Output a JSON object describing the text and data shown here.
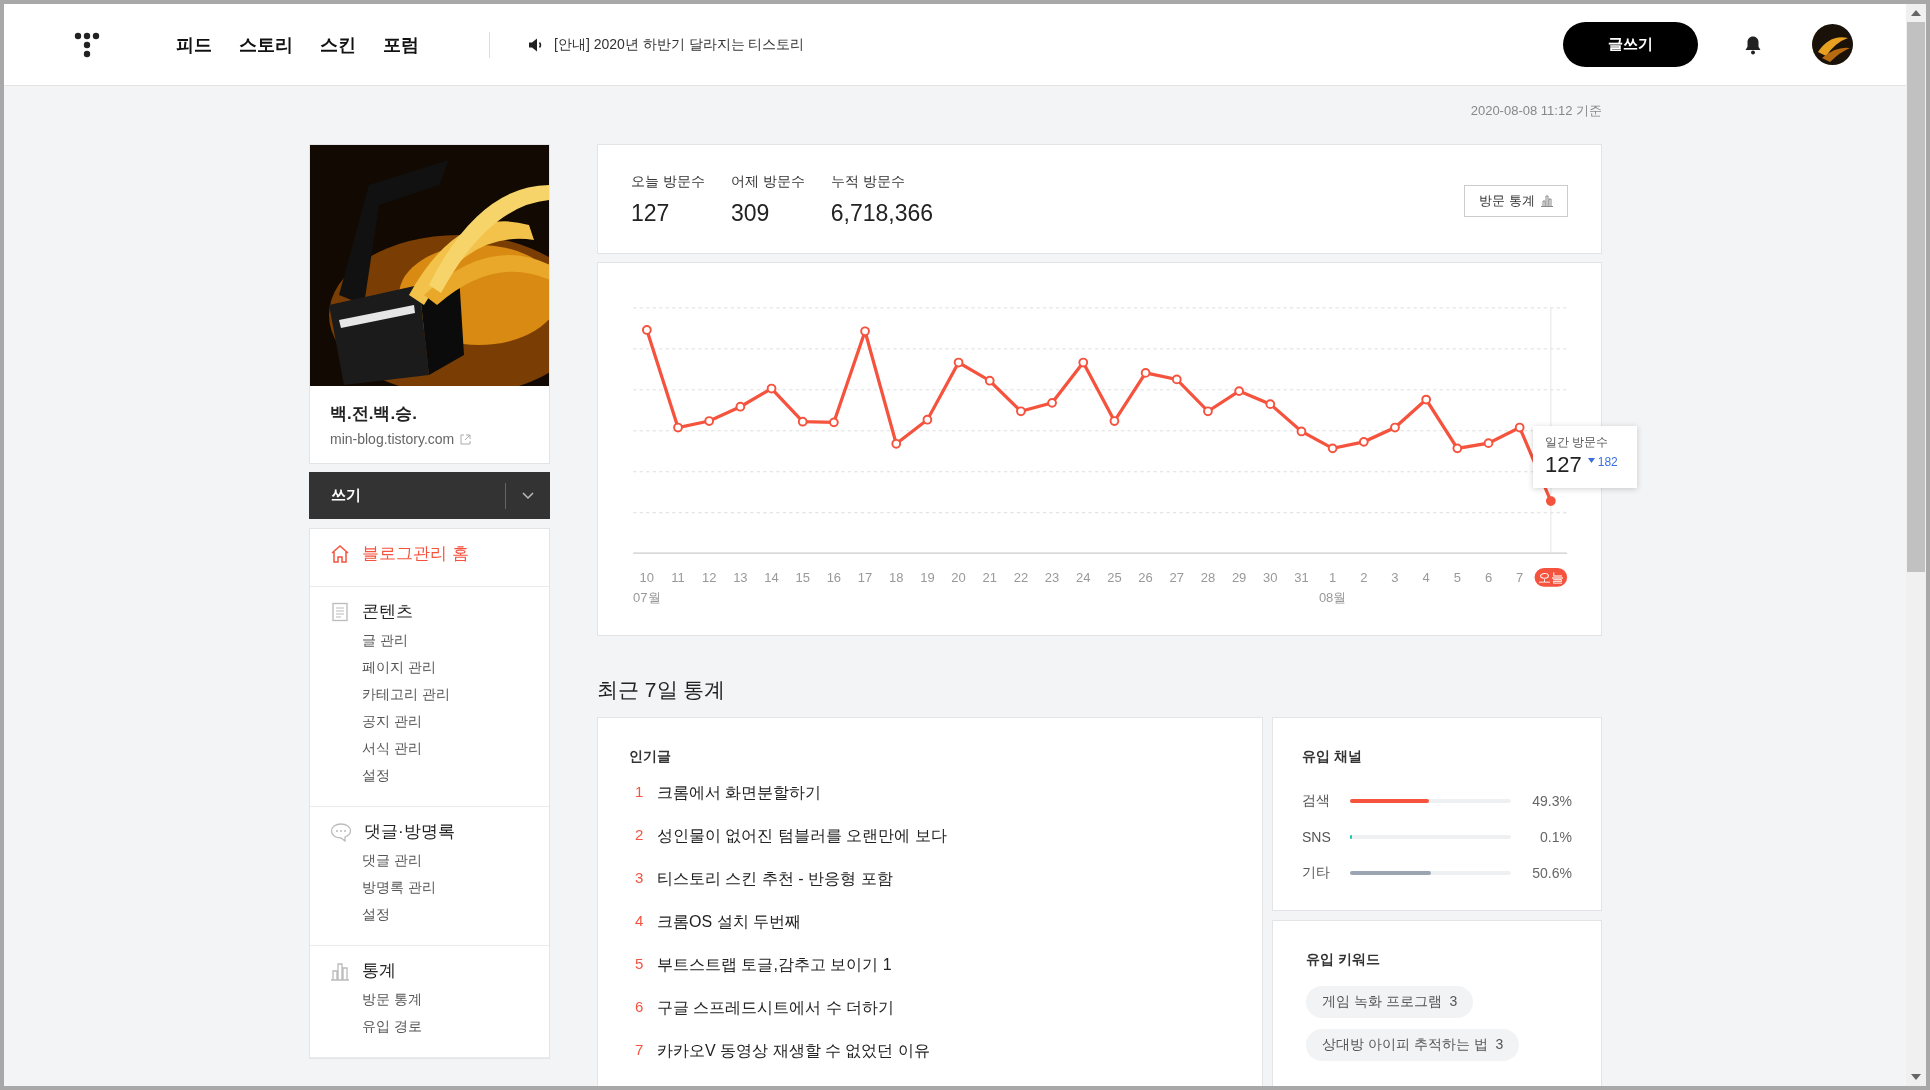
{
  "header": {
    "nav": [
      "피드",
      "스토리",
      "스킨",
      "포럼"
    ],
    "notice": "[안내] 2020년 하반기 달라지는 티스토리",
    "write_button": "글쓰기"
  },
  "timestamp": "2020-08-08 11:12 기준",
  "blog": {
    "title": "백.전.백.승.",
    "url": "min-blog.tistory.com"
  },
  "write_menu": {
    "label": "쓰기"
  },
  "sidebar": {
    "sections": [
      {
        "title": "블로그관리 홈",
        "selected": true
      },
      {
        "title": "콘텐츠",
        "selected": false,
        "children": [
          "글 관리",
          "페이지 관리",
          "카테고리 관리",
          "공지 관리",
          "서식 관리",
          "설정"
        ]
      },
      {
        "title": "댓글·방명록",
        "selected": false,
        "children": [
          "댓글 관리",
          "방명록 관리",
          "설정"
        ]
      },
      {
        "title": "통계",
        "selected": false,
        "children": [
          "방문 통계",
          "유입 경로"
        ]
      }
    ]
  },
  "stats": {
    "items": [
      {
        "label": "오늘 방문수",
        "value": "127"
      },
      {
        "label": "어제 방문수",
        "value": "309"
      },
      {
        "label": "누적 방문수",
        "value": "6,718,366"
      }
    ],
    "button": "방문 통계"
  },
  "chart": {
    "x_labels": [
      {
        "label": "10",
        "month": "07월"
      },
      {
        "label": "11"
      },
      {
        "label": "12"
      },
      {
        "label": "13"
      },
      {
        "label": "14"
      },
      {
        "label": "15"
      },
      {
        "label": "16"
      },
      {
        "label": "17"
      },
      {
        "label": "18"
      },
      {
        "label": "19"
      },
      {
        "label": "20"
      },
      {
        "label": "21"
      },
      {
        "label": "22"
      },
      {
        "label": "23"
      },
      {
        "label": "24"
      },
      {
        "label": "25"
      },
      {
        "label": "26"
      },
      {
        "label": "27"
      },
      {
        "label": "28"
      },
      {
        "label": "29"
      },
      {
        "label": "30"
      },
      {
        "label": "31"
      },
      {
        "label": "1",
        "month": "08월"
      },
      {
        "label": "2"
      },
      {
        "label": "3"
      },
      {
        "label": "4"
      },
      {
        "label": "5"
      },
      {
        "label": "6"
      },
      {
        "label": "7"
      },
      {
        "label": "오늘",
        "today": true
      }
    ],
    "tooltip": {
      "title": "일간 방문수",
      "value": "127",
      "change": "182",
      "falling": true
    }
  },
  "recent": {
    "title": "최근 7일 통계",
    "popular": {
      "title": "인기글",
      "posts": [
        {
          "rank": "1",
          "title": "크롬에서 화면분할하기"
        },
        {
          "rank": "2",
          "title": "성인물이 없어진 텀블러를 오랜만에 보다"
        },
        {
          "rank": "3",
          "title": "티스토리 스킨 추천 - 반응형 포함"
        },
        {
          "rank": "4",
          "title": "크롬OS 설치 두번째"
        },
        {
          "rank": "5",
          "title": "부트스트랩 토글,감추고 보이기 1"
        },
        {
          "rank": "6",
          "title": "구글 스프레드시트에서 수 더하기"
        },
        {
          "rank": "7",
          "title": "카카오V 동영상 재생할 수 없었던 이유"
        }
      ]
    },
    "channels": {
      "title": "유입 채널",
      "items": [
        {
          "name": "검색",
          "level": 0.493,
          "reading": "49.3%",
          "color": "#f5533d"
        },
        {
          "name": "SNS",
          "level": 0.001,
          "reading": "0.1%",
          "color": "#1ec8b0"
        },
        {
          "name": "기타",
          "level": 0.506,
          "reading": "50.6%",
          "color": "#9aa5b1"
        }
      ]
    },
    "keywords": {
      "title": "유입 키워드",
      "items": [
        {
          "text": "게임 녹화 프로그램",
          "count": "3"
        },
        {
          "text": "상대방 아이피 추적하는 법",
          "count": "3"
        }
      ]
    }
  }
}
